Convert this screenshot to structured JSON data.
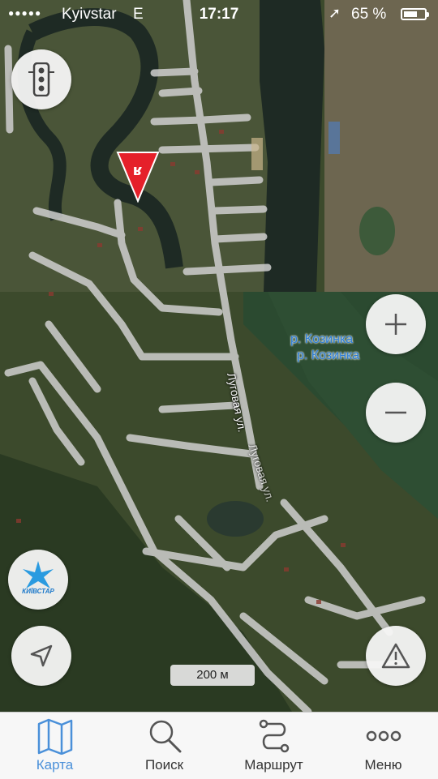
{
  "status_bar": {
    "signal_dots": "●●●●●",
    "carrier": "Kyivstar",
    "network": "E",
    "time": "17:17",
    "location_icon": "location-arrow-icon",
    "battery_percent": "65 %",
    "battery_level": 0.65
  },
  "map": {
    "river_label_1": "р. Козинка",
    "river_label_2": "р. Козинка",
    "street_label_1": "Луговая ул.",
    "street_label_2": "Луговая ул.",
    "scale_label": "200 м",
    "colors": {
      "river": "#2a4a2a",
      "water_dark": "#1f2b24",
      "vegetation": "#3a4a2a",
      "road": "#d6d6d6",
      "pin": "#e5202a"
    }
  },
  "controls": {
    "traffic": "traffic-light-icon",
    "zoom_in": "plus-icon",
    "zoom_out": "minus-icon",
    "kyivstar_logo_text": "КИЇВСТАР",
    "locate": "navigation-arrow-icon",
    "report": "warning-triangle-icon"
  },
  "tabs": [
    {
      "label": "Карта",
      "icon": "map-icon",
      "active": true
    },
    {
      "label": "Поиск",
      "icon": "search-icon",
      "active": false
    },
    {
      "label": "Маршрут",
      "icon": "route-icon",
      "active": false
    },
    {
      "label": "Меню",
      "icon": "more-icon",
      "active": false
    }
  ]
}
